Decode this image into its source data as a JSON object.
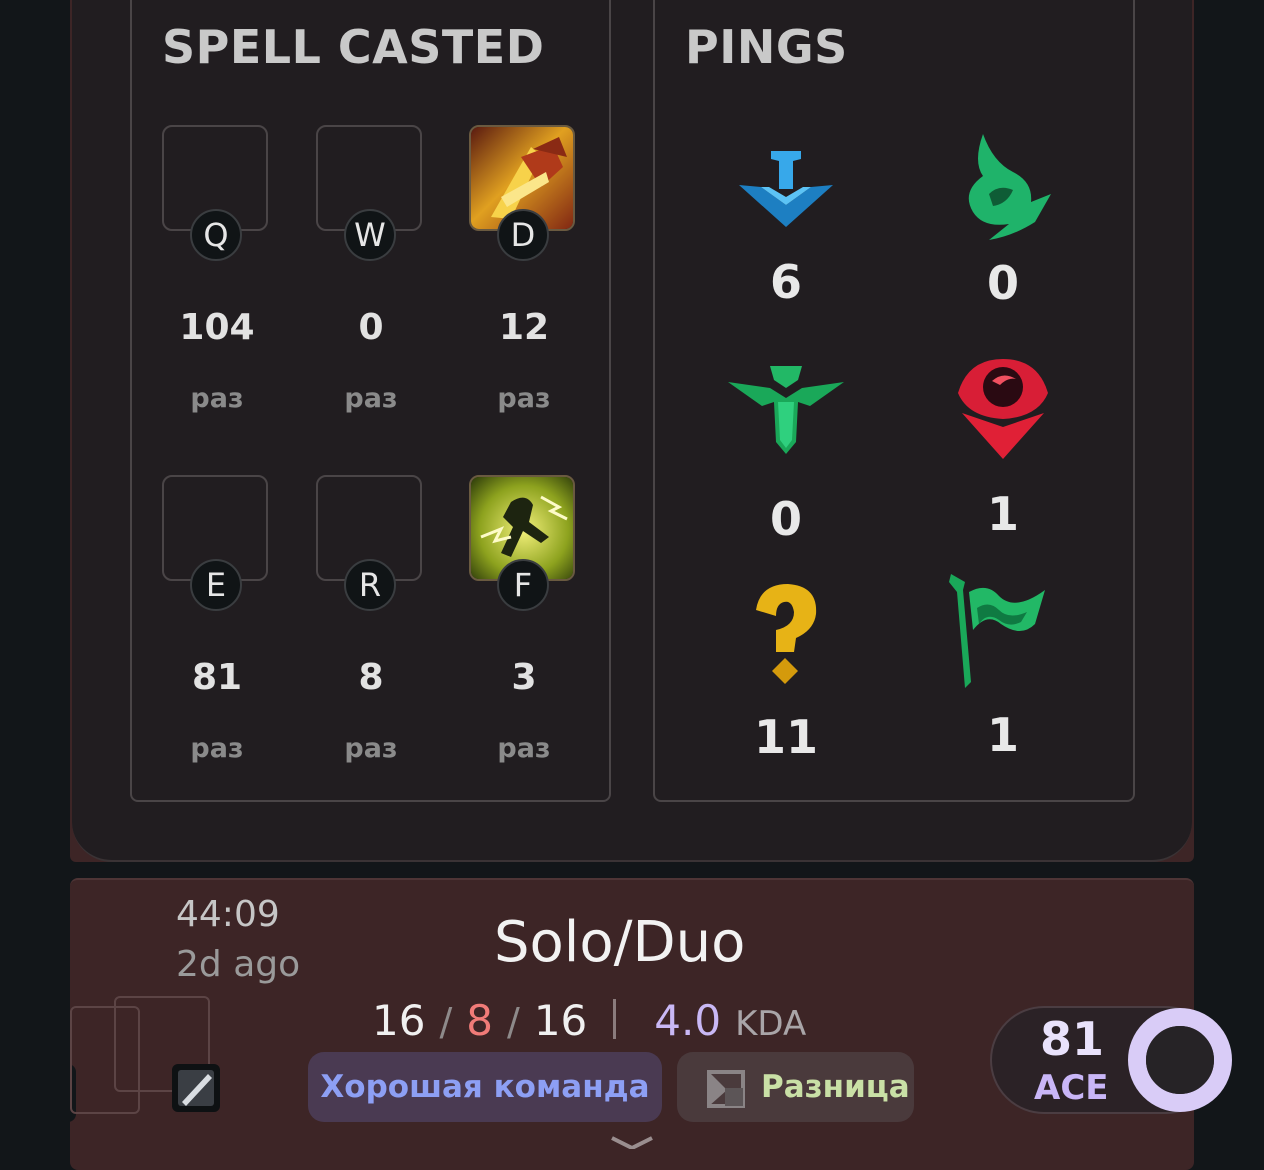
{
  "spells_panel": {
    "title": "SPELL CASTED",
    "unit": "раз",
    "slots": [
      {
        "key": "Q",
        "count": "104",
        "icon": "empty-slot"
      },
      {
        "key": "W",
        "count": "0",
        "icon": "empty-slot"
      },
      {
        "key": "D",
        "count": "12",
        "icon": "ignite-spell-icon"
      },
      {
        "key": "E",
        "count": "81",
        "icon": "empty-slot"
      },
      {
        "key": "R",
        "count": "8",
        "icon": "empty-slot"
      },
      {
        "key": "F",
        "count": "3",
        "icon": "flash-spell-icon"
      }
    ]
  },
  "pings_panel": {
    "title": "PINGS",
    "items": [
      {
        "icon": "on-my-way-ping-icon",
        "count": "6",
        "color": "#2f9be0"
      },
      {
        "icon": "assist-me-ping-icon",
        "count": "0",
        "color": "#1fb36a"
      },
      {
        "icon": "push-ping-icon",
        "count": "0",
        "color": "#22b866"
      },
      {
        "icon": "enemy-vision-ping-icon",
        "count": "1",
        "color": "#e02036"
      },
      {
        "icon": "missing-ping-icon",
        "count": "11",
        "color": "#e7b316"
      },
      {
        "icon": "need-vision-flag-ping-icon",
        "count": "1",
        "color": "#1aa859"
      }
    ]
  },
  "match": {
    "duration": "44:09",
    "ago": "2d ago",
    "queue": "Solo/Duo",
    "kills": "16",
    "deaths": "8",
    "assists": "16",
    "separator": "/",
    "kda_value": "4.0",
    "kda_label": "KDA",
    "tag_good": "Хорошая команда",
    "tag_diff": "Разница",
    "ace_score": "81",
    "ace_label": "ACE"
  },
  "colors": {
    "card_bg": "#3d2526",
    "panel_bg": "#211d20",
    "deaths": "#f07b78",
    "kda": "#c9b8f5",
    "ace_ring": "#d9ccf7"
  }
}
